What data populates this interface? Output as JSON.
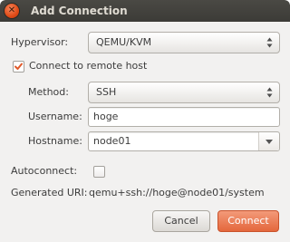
{
  "window": {
    "title": "Add Connection",
    "close_glyph": "✕"
  },
  "hypervisor": {
    "label": "Hypervisor:",
    "value": "QEMU/KVM"
  },
  "remote": {
    "label": "Connect to remote host",
    "checked": true
  },
  "method": {
    "label": "Method:",
    "value": "SSH"
  },
  "username": {
    "label": "Username:",
    "value": "hoge"
  },
  "hostname": {
    "label": "Hostname:",
    "value": "node01"
  },
  "autoconnect": {
    "label": "Autoconnect:",
    "checked": false
  },
  "uri": {
    "label": "Generated URI:",
    "value": "qemu+ssh://hoge@node01/system"
  },
  "buttons": {
    "cancel": "Cancel",
    "connect": "Connect"
  },
  "colors": {
    "accent": "#e4673c",
    "titlebar": "#3c3b37",
    "window_bg": "#f2f1f0"
  },
  "icons": {
    "close": "close-icon",
    "combo_arrows": "up-down-arrows-icon",
    "dropdown": "chevron-down-icon",
    "check": "checkmark-icon"
  }
}
